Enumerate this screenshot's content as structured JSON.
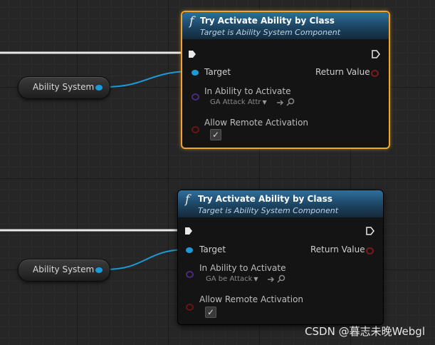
{
  "nodes": [
    {
      "func_icon": "f",
      "title": "Try Activate Ability by Class",
      "subtitle": "Target is Ability System Component",
      "target_label": "Target",
      "return_label": "Return Value",
      "ability_label": "In Ability to Activate",
      "ability_value": "GA Attack Attr",
      "remote_label": "Allow Remote Activation",
      "remote_checked": true,
      "selected": true
    },
    {
      "func_icon": "f",
      "title": "Try Activate Ability by Class",
      "subtitle": "Target is Ability System Component",
      "target_label": "Target",
      "return_label": "Return Value",
      "ability_label": "In Ability to Activate",
      "ability_value": "GA be Attack",
      "remote_label": "Allow Remote Activation",
      "remote_checked": true,
      "selected": false
    }
  ],
  "variables": [
    {
      "label": "Ability System"
    },
    {
      "label": "Ability System"
    }
  ],
  "colors": {
    "exec_wire": "#e8e8e8",
    "object_wire": "#1d9ad6",
    "selection": "#f1a52a",
    "header_blue": "#2f6f9e"
  },
  "checkbox_glyph": "✓",
  "dropdown_arrow": "▼",
  "watermark": "CSDN @暮志未晚Webgl"
}
